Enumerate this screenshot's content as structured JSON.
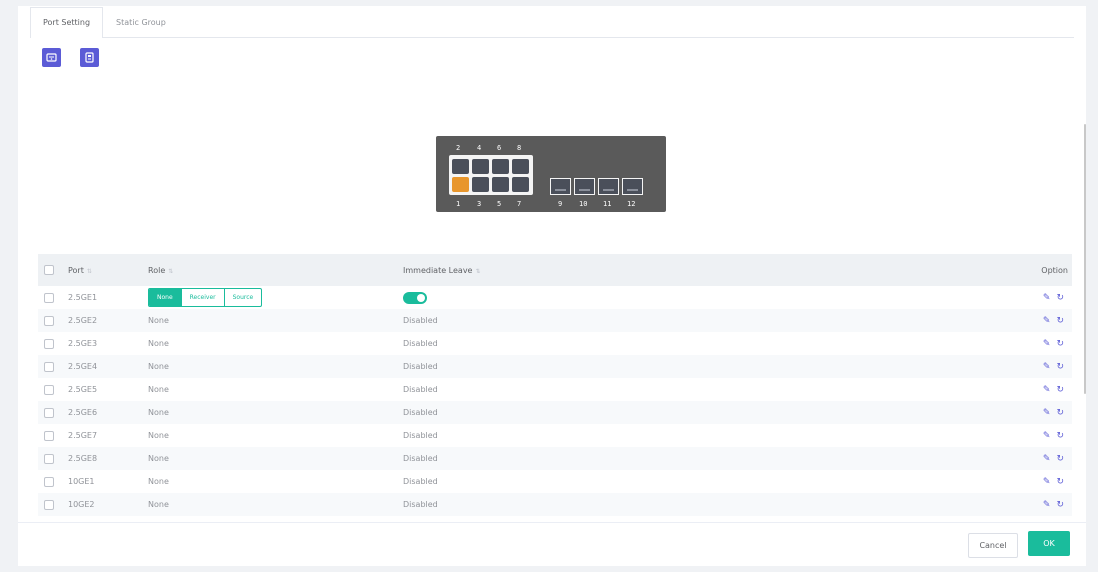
{
  "tabs": [
    {
      "label": "Port Setting",
      "active": true
    },
    {
      "label": "Static Group",
      "active": false
    }
  ],
  "toolbar": {
    "icons": [
      "router-icon",
      "switch-icon"
    ],
    "accent_color": "#5b5bd6"
  },
  "switch_diagram": {
    "top_labels": [
      "2",
      "4",
      "6",
      "8"
    ],
    "bottom_labels": [
      "1",
      "3",
      "5",
      "7",
      "9",
      "10",
      "11",
      "12"
    ],
    "active_port": "1",
    "active_color": "#e8962c"
  },
  "table": {
    "headers": {
      "port": "Port",
      "role": "Role",
      "immediate_leave": "Immediate Leave",
      "option": "Option"
    },
    "role_options": [
      "None",
      "Receiver",
      "Source"
    ],
    "selected_role": "None",
    "rows": [
      {
        "port": "2.5GE1",
        "role": "None",
        "immediate_leave": "Enabled",
        "editing": true
      },
      {
        "port": "2.5GE2",
        "role": "None",
        "immediate_leave": "Disabled"
      },
      {
        "port": "2.5GE3",
        "role": "None",
        "immediate_leave": "Disabled"
      },
      {
        "port": "2.5GE4",
        "role": "None",
        "immediate_leave": "Disabled"
      },
      {
        "port": "2.5GE5",
        "role": "None",
        "immediate_leave": "Disabled"
      },
      {
        "port": "2.5GE6",
        "role": "None",
        "immediate_leave": "Disabled"
      },
      {
        "port": "2.5GE7",
        "role": "None",
        "immediate_leave": "Disabled"
      },
      {
        "port": "2.5GE8",
        "role": "None",
        "immediate_leave": "Disabled"
      },
      {
        "port": "10GE1",
        "role": "None",
        "immediate_leave": "Disabled"
      },
      {
        "port": "10GE2",
        "role": "None",
        "immediate_leave": "Disabled"
      }
    ]
  },
  "footer": {
    "cancel_label": "Cancel",
    "ok_label": "OK",
    "ok_color": "#1abc9c"
  }
}
